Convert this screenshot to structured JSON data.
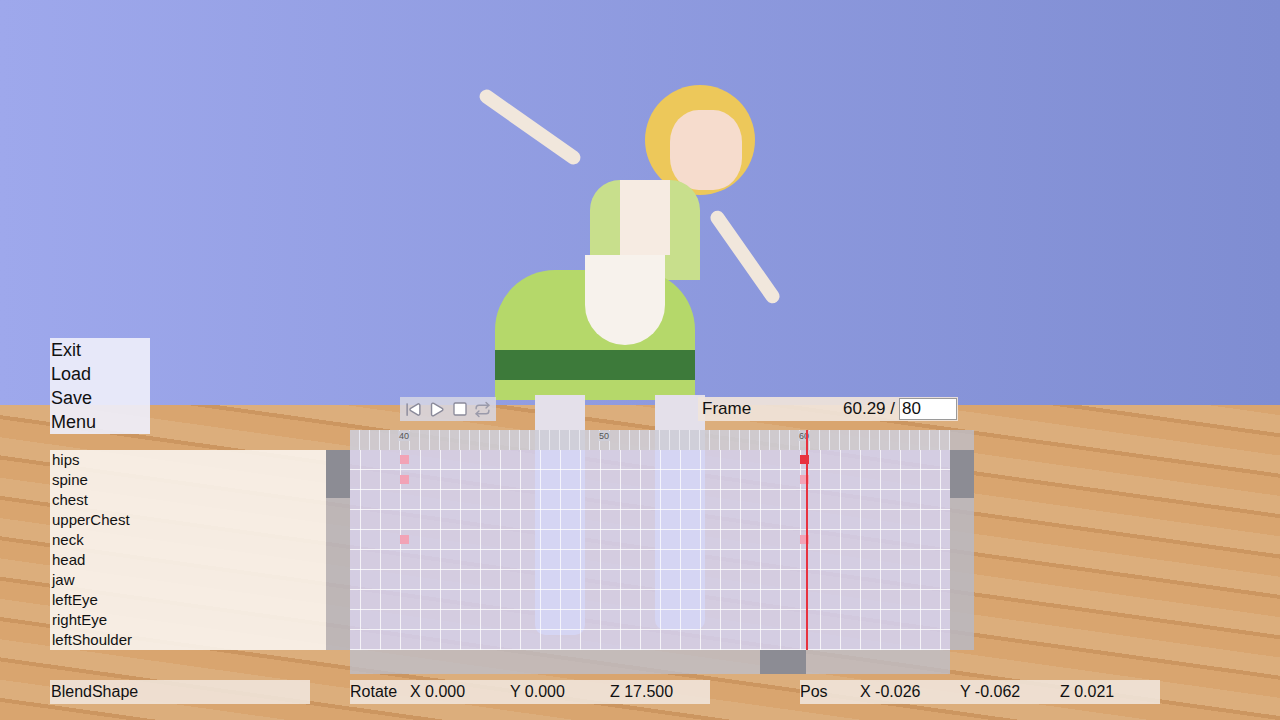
{
  "menu": [
    "Exit",
    "Load",
    "Save",
    "Menu"
  ],
  "frame": {
    "label": "Frame",
    "current": "60.29 /",
    "total": "80",
    "position": 60.29
  },
  "timeline": {
    "start_frame": 37.5,
    "ruler": [
      {
        "label": "40",
        "frame": 40
      },
      {
        "label": "50",
        "frame": 50
      },
      {
        "label": "60",
        "frame": 60
      }
    ],
    "bones": [
      {
        "name": "hips",
        "keyframes": [
          {
            "frame": 40,
            "selected": false
          },
          {
            "frame": 60,
            "selected": true
          }
        ]
      },
      {
        "name": "spine",
        "keyframes": [
          {
            "frame": 40,
            "selected": false
          },
          {
            "frame": 60,
            "selected": false
          }
        ]
      },
      {
        "name": "chest",
        "keyframes": []
      },
      {
        "name": "upperChest",
        "keyframes": []
      },
      {
        "name": "neck",
        "keyframes": [
          {
            "frame": 40,
            "selected": false
          },
          {
            "frame": 60,
            "selected": false
          }
        ]
      },
      {
        "name": "head",
        "keyframes": []
      },
      {
        "name": "jaw",
        "keyframes": []
      },
      {
        "name": "leftEye",
        "keyframes": []
      },
      {
        "name": "rightEye",
        "keyframes": []
      },
      {
        "name": "leftShoulder",
        "keyframes": []
      }
    ],
    "scrollbars": {
      "vertical": {
        "level": 0
      },
      "horizontal": {
        "level": 0.74
      }
    }
  },
  "fields": {
    "blendshape": "BlendShape",
    "rotate": {
      "label": "Rotate",
      "x": "X 0.000",
      "y": "Y 0.000",
      "z": "Z 17.500"
    },
    "pos": {
      "label": "Pos",
      "x": "X -0.026",
      "y": "Y -0.062",
      "z": "Z 0.021"
    }
  }
}
